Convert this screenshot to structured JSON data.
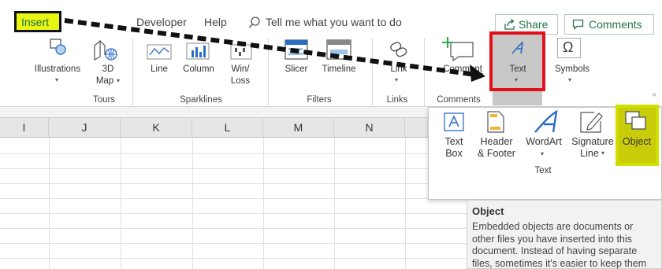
{
  "tabs": {
    "insert": "Insert",
    "developer": "Developer",
    "help": "Help",
    "tell_me": "Tell me what you want to do",
    "share": "Share",
    "comments": "Comments"
  },
  "ribbon": {
    "illustrations": "Illustrations",
    "map_3d_line1": "3D",
    "map_3d_line2": "Map",
    "tours": "Tours",
    "line": "Line",
    "column": "Column",
    "winloss_line1": "Win/",
    "winloss_line2": "Loss",
    "sparklines": "Sparklines",
    "slicer": "Slicer",
    "timeline": "Timeline",
    "filters": "Filters",
    "link": "Link",
    "links": "Links",
    "comment": "Comment",
    "comments_group": "Comments",
    "text": "Text",
    "symbols": "Symbols"
  },
  "columns": [
    "I",
    "J",
    "K",
    "L",
    "M",
    "N"
  ],
  "panel": {
    "textbox_line1": "Text",
    "textbox_line2": "Box",
    "header_line1": "Header",
    "header_line2": "& Footer",
    "wordart": "WordArt",
    "signature_line1": "Signature",
    "signature_line2": "Line",
    "object": "Object",
    "group": "Text"
  },
  "tooltip": {
    "title": "Object",
    "body": "Embedded objects are documents or other files you have inserted into this document. Instead of having separate files, sometimes it's easier to keep them all embedded in a document."
  },
  "colors": {
    "excel_green": "#217346",
    "highlight_yellow": "#e8f513",
    "annotation_red": "#e3101a",
    "icon_blue": "#2b6cc4"
  }
}
